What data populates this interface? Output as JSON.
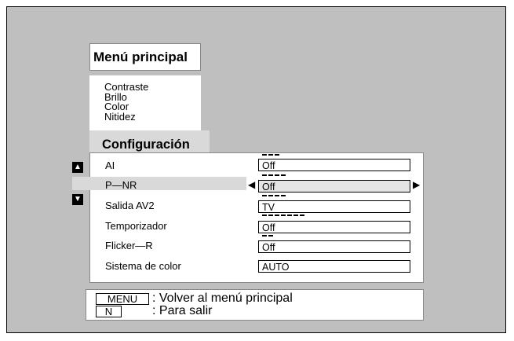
{
  "title": "Menú principal",
  "main_menu": {
    "items": [
      "Contraste",
      "Brillo",
      "Color",
      "Nitidez"
    ]
  },
  "section": "Configuración",
  "settings": [
    {
      "label": "AI",
      "value": "Off",
      "ticks": 3
    },
    {
      "label": "P—NR",
      "value": "Off",
      "ticks": 4
    },
    {
      "label": "Salida AV2",
      "value": "TV",
      "ticks": 4
    },
    {
      "label": "Temporizador",
      "value": "Off",
      "ticks": 7
    },
    {
      "label": "Flicker—R",
      "value": "Off",
      "ticks": 2
    },
    {
      "label": "Sistema de color",
      "value": "AUTO",
      "ticks": 0
    }
  ],
  "selected_index": 1,
  "icons": {
    "scroll_up": "triangle-up-icon",
    "scroll_down": "triangle-down-icon",
    "prev": "arrow-left-icon",
    "next": "arrow-right-icon"
  },
  "help": [
    {
      "key": "MENU",
      "text": ": Volver al menú principal"
    },
    {
      "key": "N",
      "text": ": Para salir"
    }
  ]
}
